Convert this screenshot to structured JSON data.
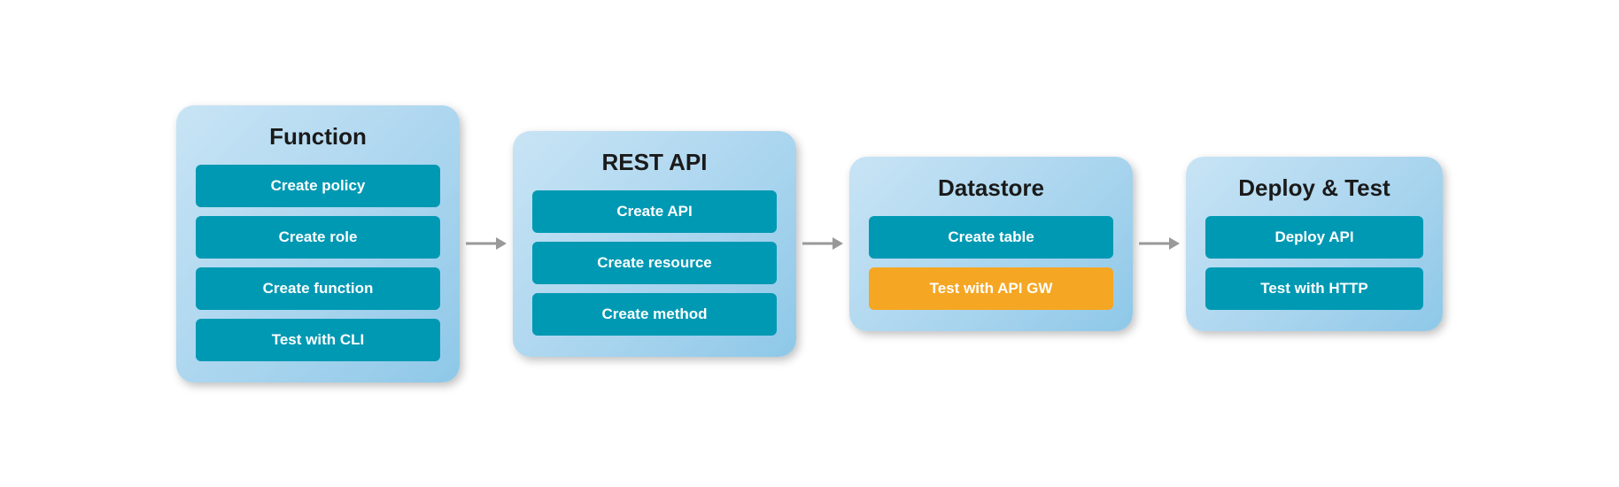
{
  "panels": [
    {
      "id": "function",
      "title": "Function",
      "items": [
        {
          "label": "Create policy",
          "style": "teal"
        },
        {
          "label": "Create role",
          "style": "teal"
        },
        {
          "label": "Create function",
          "style": "teal"
        },
        {
          "label": "Test with CLI",
          "style": "teal"
        }
      ]
    },
    {
      "id": "rest-api",
      "title": "REST API",
      "items": [
        {
          "label": "Create API",
          "style": "teal"
        },
        {
          "label": "Create resource",
          "style": "teal"
        },
        {
          "label": "Create method",
          "style": "teal"
        }
      ]
    },
    {
      "id": "datastore",
      "title": "Datastore",
      "items": [
        {
          "label": "Create table",
          "style": "teal"
        },
        {
          "label": "Test with API GW",
          "style": "orange"
        }
      ]
    },
    {
      "id": "deploy-test",
      "title": "Deploy & Test",
      "items": [
        {
          "label": "Deploy API",
          "style": "teal"
        },
        {
          "label": "Test with HTTP",
          "style": "teal"
        }
      ]
    }
  ],
  "arrows": [
    "→",
    "→",
    "→"
  ]
}
